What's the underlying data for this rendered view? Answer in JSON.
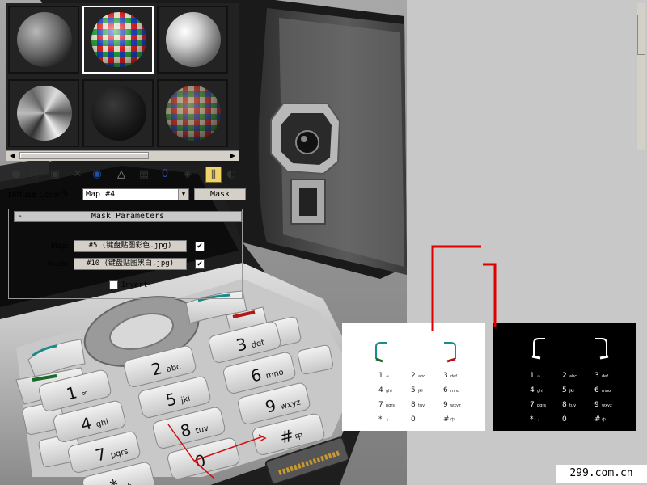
{
  "viewport": {
    "keypad_keys": [
      {
        "num": "1",
        "sub": "∞"
      },
      {
        "num": "2",
        "sub": "abc"
      },
      {
        "num": "3",
        "sub": "def"
      },
      {
        "num": "4",
        "sub": "ghi"
      },
      {
        "num": "5",
        "sub": "jkl"
      },
      {
        "num": "6",
        "sub": "mno"
      },
      {
        "num": "7",
        "sub": "pqrs"
      },
      {
        "num": "8",
        "sub": "tuv"
      },
      {
        "num": "9",
        "sub": "wxyz"
      },
      {
        "num": "*",
        "sub": "+"
      },
      {
        "num": "0",
        "sub": ""
      },
      {
        "num": "#",
        "sub": "中"
      }
    ]
  },
  "material_editor": {
    "slots": [
      {
        "name": "grey-sphere",
        "active": false
      },
      {
        "name": "checker-sphere",
        "active": true
      },
      {
        "name": "white-glossy-sphere",
        "active": false
      },
      {
        "name": "chrome-sphere",
        "active": false
      },
      {
        "name": "black-sphere",
        "active": false
      },
      {
        "name": "checker-dark-sphere",
        "active": false
      }
    ],
    "toolbar_icons": [
      "get-material-icon",
      "put-to-scene-icon",
      "assign-icon",
      "delete-icon",
      "make-unique-icon",
      "put-library-icon",
      "effects-channel-icon",
      "show-map-icon",
      "show-end-icon",
      "go-parent-icon",
      "go-sibling-icon"
    ],
    "diffuse_label": "Diffuse Color:",
    "map_value": "Map #4",
    "map_type": "Mask",
    "rollout_title": "Mask Parameters",
    "rollout_toggle": "-",
    "map_row": {
      "label": "Map:",
      "value": "#5 (键盘贴图彩色.jpg)",
      "checked": true
    },
    "mask_row": {
      "label": "Mask:",
      "value": "#10 (键盘贴图黑白.jpg)",
      "checked": true
    },
    "invert_label": "Invert",
    "invert_checked": false
  },
  "watermark": "299.com.cn",
  "colors": {
    "accent": "#e00000",
    "panel": "#c8c8c8",
    "active_tool": "#f2d36b"
  }
}
